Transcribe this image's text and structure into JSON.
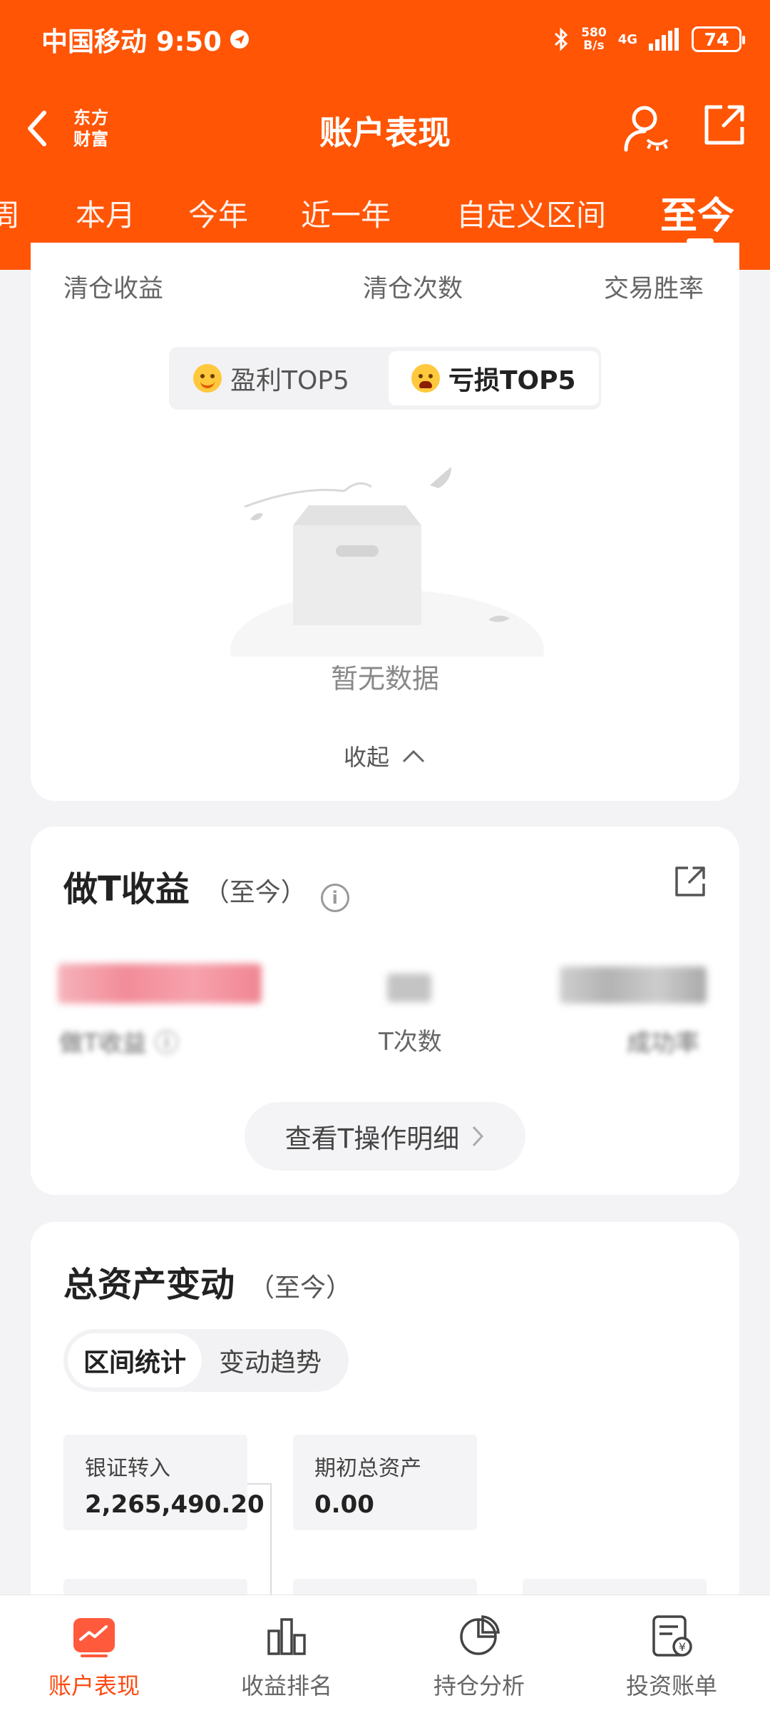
{
  "status_bar": {
    "carrier_time": "中国移动 9:50",
    "net_speed_value": "580",
    "net_speed_unit": "B/s",
    "network": "4G",
    "battery": "74"
  },
  "nav": {
    "logo_line1": "东方",
    "logo_line2": "财富",
    "title": "账户表现"
  },
  "period_tabs": [
    "周",
    "本月",
    "今年",
    "近一年",
    "自定义区间",
    "至今"
  ],
  "active_period": "至今",
  "clearance": {
    "labels": [
      "清仓收益",
      "清仓次数",
      "交易胜率"
    ],
    "toggle": {
      "profit": "盈利TOP5",
      "loss": "亏损TOP5"
    },
    "empty_text": "暂无数据",
    "collapse_label": "收起"
  },
  "t_trade": {
    "title": "做T收益",
    "period": "（至今）",
    "count_label": "T次数",
    "detail_button": "查看T操作明细"
  },
  "total_assets": {
    "title": "总资产变动",
    "period": "（至今）",
    "tabs": [
      "区间统计",
      "变动趋势"
    ],
    "stats": [
      {
        "label": "银证转入",
        "value": "2,265,490.20"
      },
      {
        "label": "期初总资产",
        "value": "0.00"
      }
    ]
  },
  "bottom_nav": [
    "账户表现",
    "收益排名",
    "持仓分析",
    "投资账单"
  ],
  "colors": {
    "brand": "#ff5505",
    "active_nav": "#ff4a10"
  }
}
